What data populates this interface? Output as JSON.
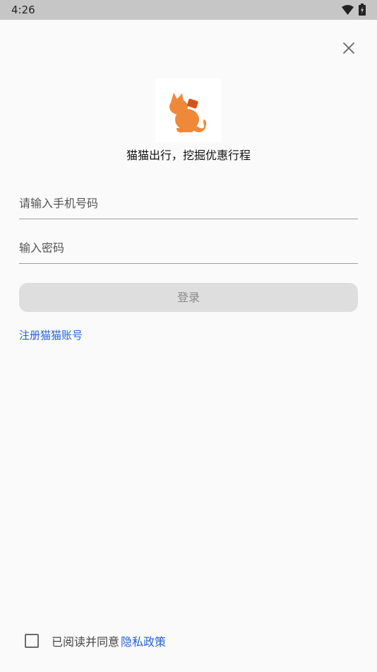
{
  "status_bar": {
    "time": "4:26"
  },
  "icons": {
    "close": "close-icon",
    "wifi": "wifi-icon",
    "battery": "battery-icon",
    "logo": "cat-logo"
  },
  "colors": {
    "accent_link": "#2762d9",
    "logo_orange": "#f0883a",
    "logo_dark_orange": "#d4541c",
    "button_disabled": "#dedede"
  },
  "header": {
    "slogan": "猫猫出行，挖掘优惠行程"
  },
  "form": {
    "phone_placeholder": "请输入手机号码",
    "phone_value": "",
    "password_placeholder": "输入密码",
    "password_value": "",
    "login_label": "登录",
    "register_label": "注册猫猫账号"
  },
  "agreement": {
    "text": "已阅读并同意",
    "policy_label": "隐私政策",
    "checked": false
  }
}
